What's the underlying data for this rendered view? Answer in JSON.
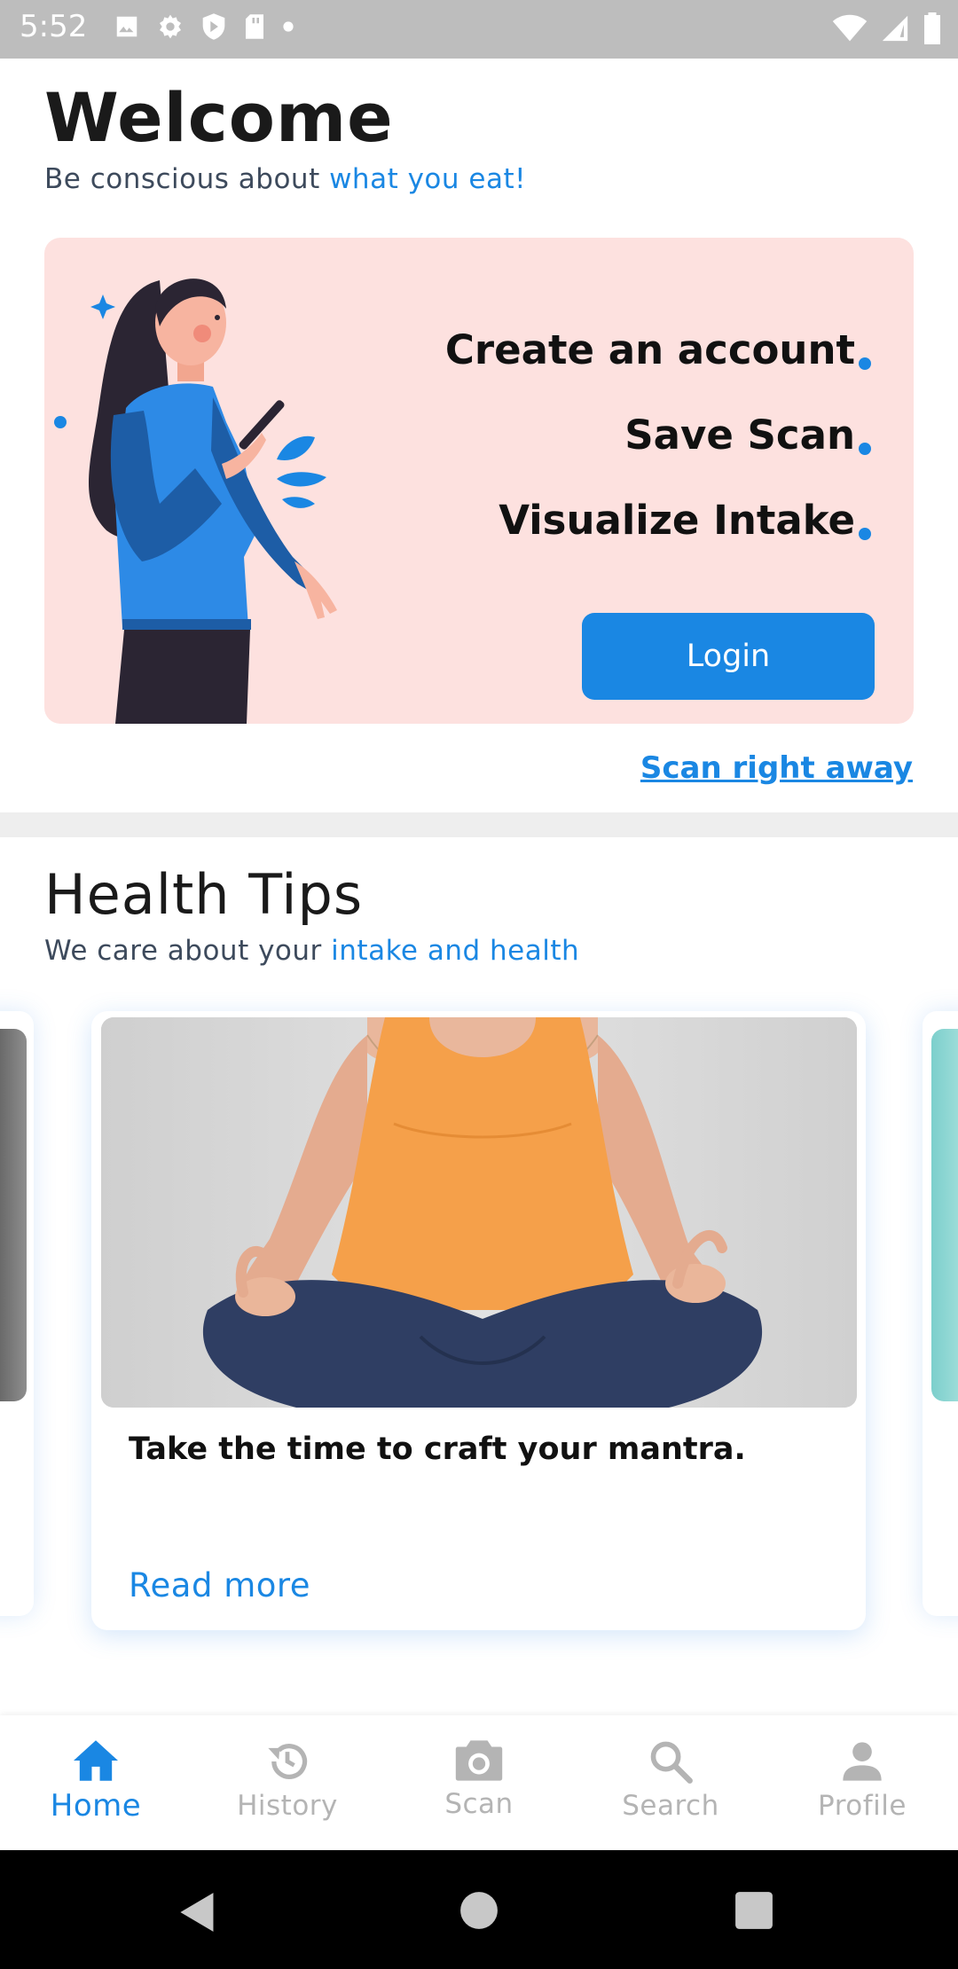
{
  "status_bar": {
    "time": "5:52"
  },
  "welcome": {
    "title": "Welcome",
    "subtitle_plain": "Be conscious about ",
    "subtitle_accent": "what you eat!"
  },
  "hero": {
    "features": [
      "Create an account",
      "Save Scan",
      "Visualize Intake"
    ],
    "login_label": "Login",
    "scan_link": "Scan right away"
  },
  "health_tips": {
    "title": "Health Tips",
    "subtitle_plain": "We care about your ",
    "subtitle_accent": "intake and health",
    "card": {
      "title": "Take the time to craft your mantra.",
      "read_more": "Read more"
    }
  },
  "bottom_nav": {
    "items": [
      {
        "label": "Home",
        "icon": "home-icon",
        "active": true
      },
      {
        "label": "History",
        "icon": "history-icon",
        "active": false
      },
      {
        "label": "Scan",
        "icon": "camera-icon",
        "active": false
      },
      {
        "label": "Search",
        "icon": "search-icon",
        "active": false
      },
      {
        "label": "Profile",
        "icon": "person-icon",
        "active": false
      }
    ]
  },
  "colors": {
    "accent": "#1a87e3",
    "hero_bg": "#fde1df",
    "status_bar": "#bdbdbd"
  }
}
